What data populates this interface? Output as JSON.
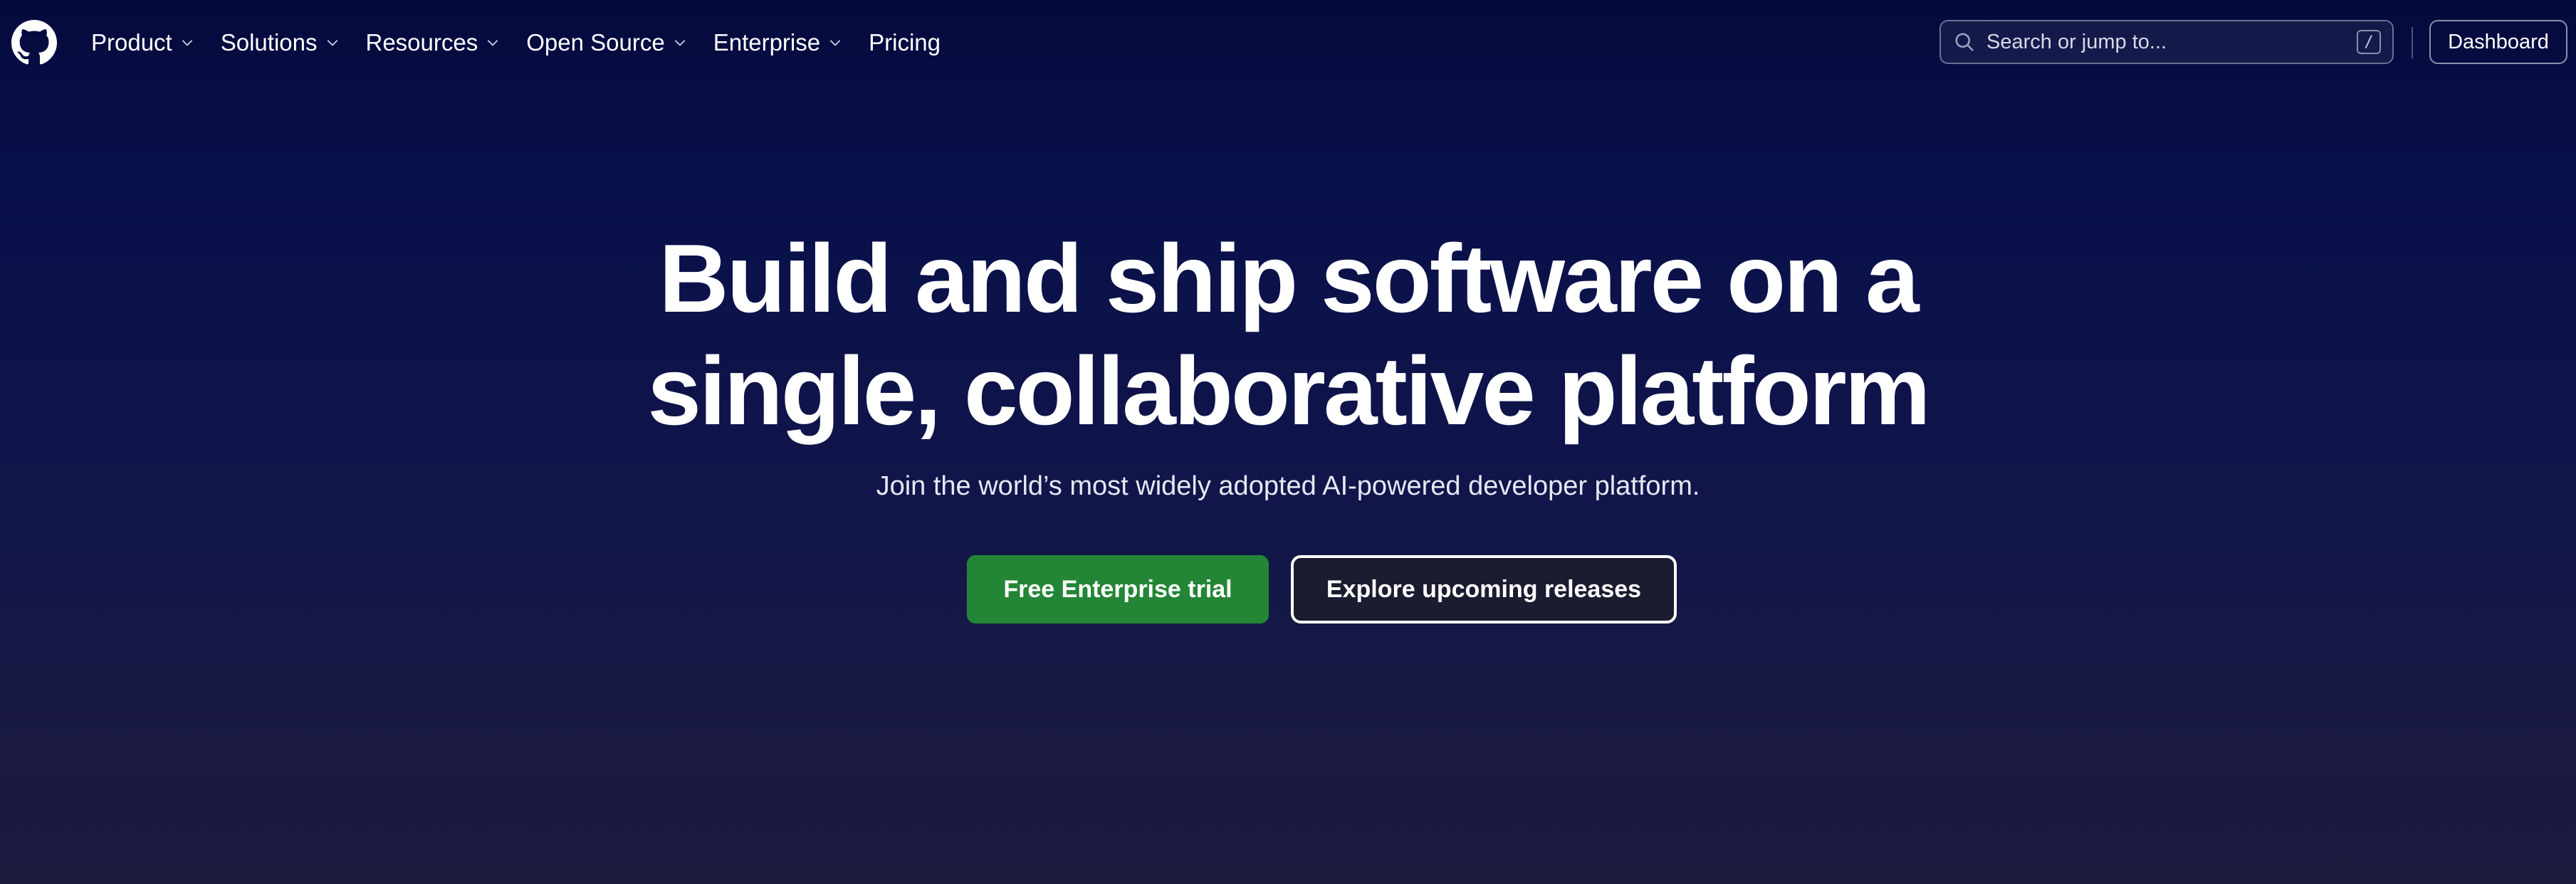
{
  "header": {
    "logo_icon": "github-octocat-icon",
    "nav": [
      {
        "label": "Product",
        "has_dropdown": true
      },
      {
        "label": "Solutions",
        "has_dropdown": true
      },
      {
        "label": "Resources",
        "has_dropdown": true
      },
      {
        "label": "Open Source",
        "has_dropdown": true
      },
      {
        "label": "Enterprise",
        "has_dropdown": true
      },
      {
        "label": "Pricing",
        "has_dropdown": false
      }
    ],
    "search": {
      "placeholder": "Search or jump to...",
      "shortcut": "/"
    },
    "dashboard_label": "Dashboard"
  },
  "hero": {
    "title_line1": "Build and ship software on a",
    "title_line2": "single, collaborative platform",
    "subtitle": "Join the world’s most widely adopted AI-powered developer platform.",
    "primary_cta": "Free Enterprise trial",
    "secondary_cta": "Explore upcoming releases"
  },
  "colors": {
    "background_top": "#050a3c",
    "background_bottom": "#1b1b3e",
    "primary_button": "#238636",
    "text": "#ffffff"
  }
}
